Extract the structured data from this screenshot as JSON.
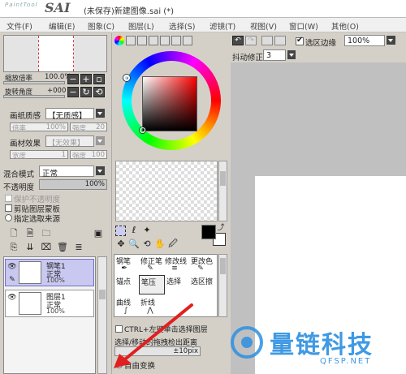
{
  "app": {
    "logo_small": "PaintTool",
    "logo_big": "SAI",
    "title": "(未保存)新建图像.sai (*)"
  },
  "menu": [
    "文件(F)",
    "编辑(E)",
    "图象(C)",
    "图层(L)",
    "选择(S)",
    "滤镜(T)",
    "视图(V)",
    "窗口(W)",
    "其他(O)"
  ],
  "navigator": {
    "zoom_label": "缩放倍率",
    "zoom_value": "100.0%",
    "rotate_label": "旋转角度",
    "rotate_value": "+000"
  },
  "paper": {
    "texture_label": "画纸质感",
    "texture_value": "【无质感】",
    "scale_label": "倍率",
    "scale_value": "100%",
    "strength_label": "强度",
    "strength_value": "20",
    "effect_label": "画材效果",
    "effect_value": "【无效果】",
    "width_label": "宽度",
    "width_value": "1",
    "strength2_label": "强度",
    "strength2_value": "100"
  },
  "layer_props": {
    "blend_label": "混合模式",
    "blend_value": "正常",
    "opacity_label": "不透明度",
    "opacity_value": "100%",
    "opacity_fraction": 1.0,
    "protect_opacity": "保护不透明度",
    "clip_group": "剪贴图层蒙板",
    "select_source": "指定选取来源"
  },
  "layers": [
    {
      "name": "钢笔1",
      "mode": "正常",
      "opacity": "100%",
      "selected": true
    },
    {
      "name": "图层1",
      "mode": "正常",
      "opacity": "100%",
      "selected": false
    }
  ],
  "toolbar": {
    "select_edge_label": "选区边缘",
    "zoom_value": "100%",
    "stabilizer_label": "抖动修正",
    "stabilizer_value": "3"
  },
  "tools": {
    "pen": "钢笔",
    "modify_pen": "修正笔",
    "edit_line": "修改线",
    "change_color": "更改色",
    "anchor": "锚点",
    "pressure": "笔压",
    "select": "选择",
    "sel_erase": "选区擦",
    "curve": "曲线",
    "polyline": "折线"
  },
  "tool_options": {
    "ctrl_select": "CTRL+左键单击选择图层",
    "select_detect": "选择/移动的拖拽检出距离",
    "distance_value": "±10pix",
    "free_transform": "自由变换"
  },
  "watermark": {
    "name": "量链科技",
    "url": "QFSP.NET"
  },
  "colors": {
    "foreground": "#000000",
    "background": "#ffffff",
    "canvas_bg": "#c0c0c0",
    "accent_arrow": "#e02020",
    "watermark": "#2b8fe0"
  }
}
